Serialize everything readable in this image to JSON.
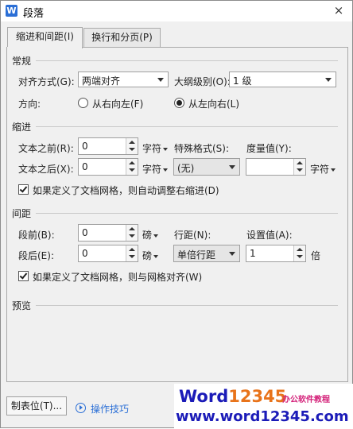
{
  "window": {
    "title": "段落",
    "app_icon_letter": "W",
    "close_glyph": "×"
  },
  "tabs": [
    {
      "label": "缩进和间距(I)",
      "active": true
    },
    {
      "label": "换行和分页(P)",
      "active": false
    }
  ],
  "general": {
    "heading": "常规",
    "alignment_label": "对齐方式(G):",
    "alignment_value": "两端对齐",
    "outline_label": "大纲级别(O):",
    "outline_value": "1 级",
    "direction_label": "方向:",
    "rtl_label": "从右向左(F)",
    "ltr_label": "从左向右(L)",
    "selected_direction": "ltr"
  },
  "indent": {
    "heading": "缩进",
    "before_label": "文本之前(R):",
    "before_value": "0",
    "before_unit": "字符",
    "after_label": "文本之后(X):",
    "after_value": "0",
    "after_unit": "字符",
    "special_label": "特殊格式(S):",
    "special_value": "(无)",
    "measure_label": "度量值(Y):",
    "measure_value": "",
    "measure_unit": "字符",
    "grid_checkbox_label": "如果定义了文档网格，则自动调整右缩进(D)",
    "grid_checked": true
  },
  "spacing": {
    "heading": "间距",
    "before_label": "段前(B):",
    "before_value": "0",
    "before_unit": "磅",
    "after_label": "段后(E):",
    "after_value": "0",
    "after_unit": "磅",
    "line_label": "行距(N):",
    "line_value": "单倍行距",
    "setting_label": "设置值(A):",
    "setting_value": "1",
    "setting_unit": "倍",
    "grid_checkbox_label": "如果定义了文档网格，则与网格对齐(W)",
    "grid_checked": true
  },
  "preview": {
    "heading": "预览"
  },
  "footer": {
    "tabs_button": "制表位(T)...",
    "tips_link": "操作技巧"
  },
  "watermark": {
    "brand_word": "Word",
    "brand_num": "12345",
    "brand_sub": "办公软件教程",
    "url": "www.word12345.com"
  },
  "colors": {
    "accent": "#2b6fd6",
    "watermark_orange": "#e8731a",
    "watermark_blue": "#1b1bb8",
    "watermark_pink": "#d4227a"
  }
}
